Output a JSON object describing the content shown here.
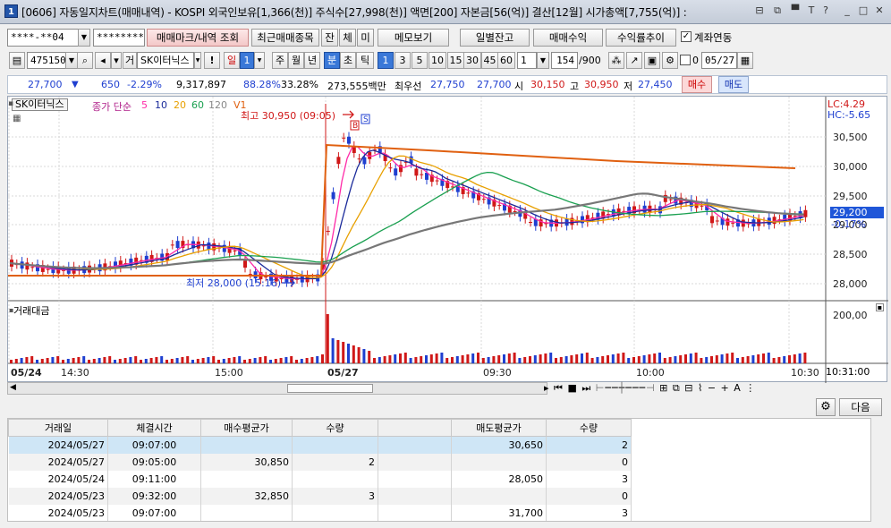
{
  "window": {
    "icon_label": "1",
    "title": "[0606] 자동일지차트(매매내역) - KOSPI 외국인보유[1,366(천)] 주식수[27,998(천)] 액면[200] 자본금[56(억)] 결산[12월] 시가총액[7,755(억)] :",
    "controls": [
      "⊟",
      "⧉",
      "▀",
      "T",
      "?",
      "_",
      "□",
      "✕"
    ]
  },
  "toolbar1": {
    "account": "****-**04",
    "password": "********",
    "trade_mark_button": "매매마크/내역 조회",
    "recent_button": "최근매매종목",
    "mini_tabs": [
      "잔",
      "체",
      "미"
    ],
    "memo_button": "메모보기",
    "daily_balance_button": "일별잔고",
    "profit_button": "수익률추이",
    "trade_profit_button": "매매수익",
    "link_checkbox_label": "계좌연동",
    "link_checked": true
  },
  "toolbar2": {
    "code": "475150",
    "stock_name_prefix": "거",
    "stock_name": "SK이터닉스",
    "period_one": "일",
    "period_value": "1",
    "periods": [
      "주",
      "월",
      "년"
    ],
    "period_min": "분",
    "period_sec": "초",
    "period_tick": "틱",
    "interval_buttons": [
      "1",
      "3",
      "5",
      "10",
      "15",
      "30",
      "45",
      "60"
    ],
    "interval_selected": "1",
    "interval_value": "1",
    "count": "154",
    "count_max": "/900",
    "check_label": "0",
    "date": "05/27"
  },
  "quote": {
    "price": "27,700",
    "arrow": "▼",
    "change": "650",
    "change_pct": "-2.29%",
    "volume": "9,317,897",
    "pct1": "88.28%",
    "pct2": "33.28%",
    "amount": "273,555백만",
    "best_label": "최우선",
    "best_ask": "27,750",
    "best_bid": "27,700",
    "open_label": "시",
    "open": "30,150",
    "high_label": "고",
    "high": "30,950",
    "low_label": "저",
    "low": "27,450",
    "buy_button": "매수",
    "sell_button": "매도"
  },
  "chart_data": {
    "type": "candlestick",
    "stock": "SK이터닉스",
    "indicator_label": "종가 단순",
    "ma_periods": [
      "5",
      "10",
      "20",
      "60",
      "120"
    ],
    "ma_colors": [
      "#ff2aa8",
      "#1a2a9a",
      "#e8a000",
      "#1aa050",
      "#777777"
    ],
    "volume_label": "V1",
    "extra_line_color": "#e06010",
    "y_ticks": [
      "30,500",
      "30,000",
      "29,500",
      "29,000",
      "28,500",
      "28,000"
    ],
    "y_min": 27,
    "y_max": 30,
    "lc_label": "LC:4.29",
    "hc_label": "HC:-5.65",
    "current_price_label": "29,200",
    "current_pct_label": "-0.17%",
    "high_annotation": "최고 30,950 (09:05)",
    "low_annotation": "최저 28,000 (15:16)",
    "buy_mark": "B",
    "sell_mark": "S",
    "volume_panel_title": "거래대금",
    "volume_tick": "200,00",
    "x_labels": [
      "05/24",
      "14:30",
      "15:00",
      "05/27",
      "09:30",
      "10:00",
      "10:30"
    ],
    "x_end_label": "10:31:00"
  },
  "bottom": {
    "next_button": "다음",
    "columns": [
      "거래일",
      "체결시간",
      "매수평균가",
      "수량",
      "",
      "매도평균가",
      "수량"
    ],
    "rows": [
      [
        "2024/05/27",
        "09:07:00",
        "",
        "",
        "",
        "30,650",
        "2"
      ],
      [
        "2024/05/27",
        "09:05:00",
        "30,850",
        "2",
        "",
        "",
        "0"
      ],
      [
        "2024/05/24",
        "09:11:00",
        "",
        "",
        "",
        "28,050",
        "3"
      ],
      [
        "2024/05/23",
        "09:32:00",
        "32,850",
        "3",
        "",
        "",
        "0"
      ],
      [
        "2024/05/23",
        "09:07:00",
        "",
        "",
        "",
        "31,700",
        "3"
      ]
    ]
  }
}
